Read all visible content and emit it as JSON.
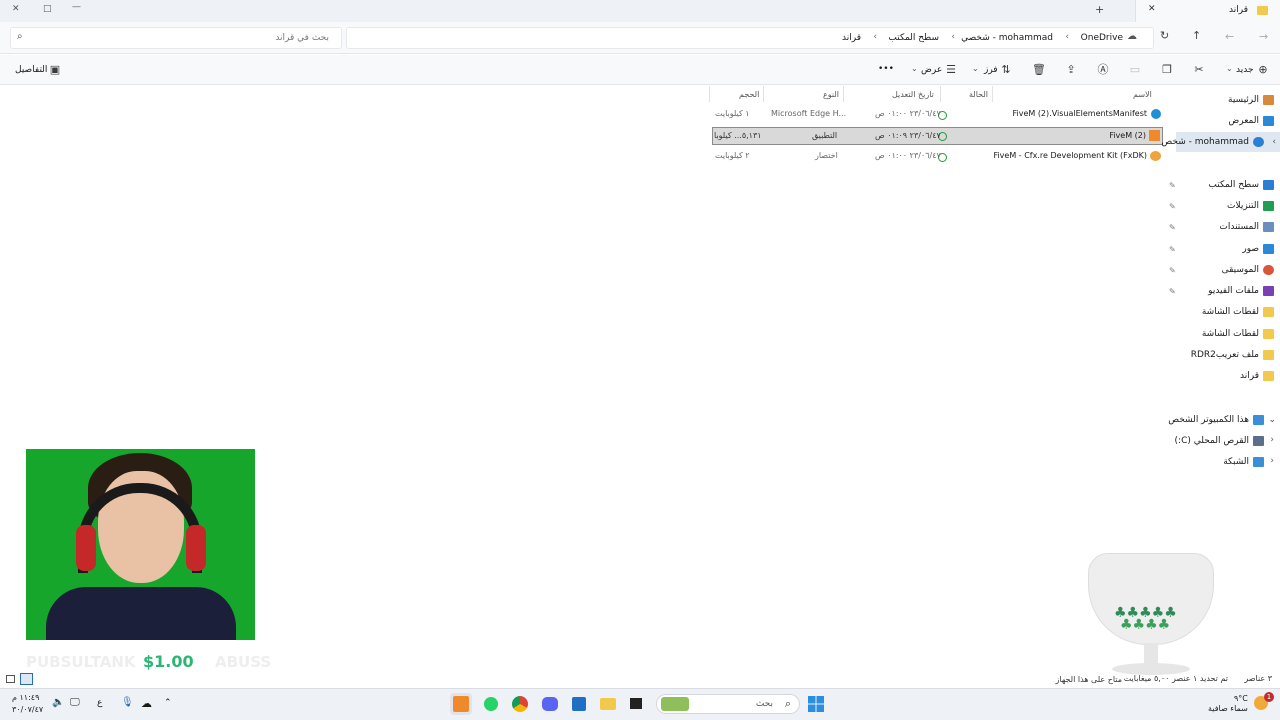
{
  "window": {
    "tab_title": "قراند",
    "controls": {
      "minimize": "—",
      "maximize": "□",
      "close": "✕"
    }
  },
  "address": {
    "breadcrumbs": [
      "OneDrive",
      "شخصي - mohammad",
      "سطح المكتب",
      "قراند"
    ],
    "search_placeholder": "بحث في قراند"
  },
  "toolbar": {
    "new_label": "جديد",
    "sort_label": "فرز",
    "view_label": "عرض",
    "more_label": "•••",
    "details_label": "التفاصيل"
  },
  "columns": {
    "name": "الاسم",
    "status": "الحالة",
    "modified": "تاريخ التعديل",
    "type": "النوع",
    "size": "الحجم"
  },
  "files": [
    {
      "name": "FiveM (2).VisualElementsManifest",
      "modified": "٢٣/٠٦/٤٧ ٠١:٠٠ ص",
      "type": "Microsoft Edge H...",
      "size": "١ كيلوبايت"
    },
    {
      "name": "FiveM (2)",
      "modified": "٢٣/٠٦/٤٧ ٠١:٠٩ ص",
      "type": "التطبيق",
      "size": "٥,١٣١... كيلوبا"
    },
    {
      "name": "FiveM - Cfx.re Development Kit (FxDK)",
      "modified": "٢٣/٠٦/٤٧ ٠١:٠٠ ص",
      "type": "اختصار",
      "size": "٢ كيلوبايت"
    }
  ],
  "sidebar": {
    "home": "الرئيسية",
    "gallery": "المعرض",
    "onedrive": "mohammad - شخص",
    "pinned": [
      {
        "label": "سطح المكتب",
        "color": "#2a7fd4"
      },
      {
        "label": "التنزيلات",
        "color": "#1f9d55"
      },
      {
        "label": "المستندات",
        "color": "#6c8ebf"
      },
      {
        "label": "صور",
        "color": "#2b88d8"
      },
      {
        "label": "الموسيقى",
        "color": "#d8573a"
      },
      {
        "label": "ملفات الفيديو",
        "color": "#7a3fb0"
      },
      {
        "label": "لقطات الشاشة",
        "color": "#f2c94c"
      },
      {
        "label": "لقطات الشاشة",
        "color": "#f2c94c"
      },
      {
        "label": "ملف تعريبRDR2",
        "color": "#f2c94c"
      },
      {
        "label": "قراند",
        "color": "#f2c94c"
      }
    ],
    "this_pc": "هذا الكمبيوتر الشخص",
    "local_disk": "القرص المحلي (C:)",
    "network": "الشبكة"
  },
  "status": {
    "items_count": "٣ عناصر",
    "selection": "تم تحديد ١ عنصر ٥,٠٠ ميغابايت",
    "availability": "متاح على هذا الجهاز"
  },
  "overlay": {
    "donation": "$1.00",
    "left_text": "PUBSULTANK",
    "right_text": "ABUSS"
  },
  "taskbar": {
    "weather_temp": "٩°C",
    "weather_desc": "سماء صافية",
    "notification_count": "1",
    "search_placeholder": "بحث",
    "time": "١١:٤٩ م",
    "date": "٣٠/٠٧/٤٧",
    "lang": "ع"
  }
}
